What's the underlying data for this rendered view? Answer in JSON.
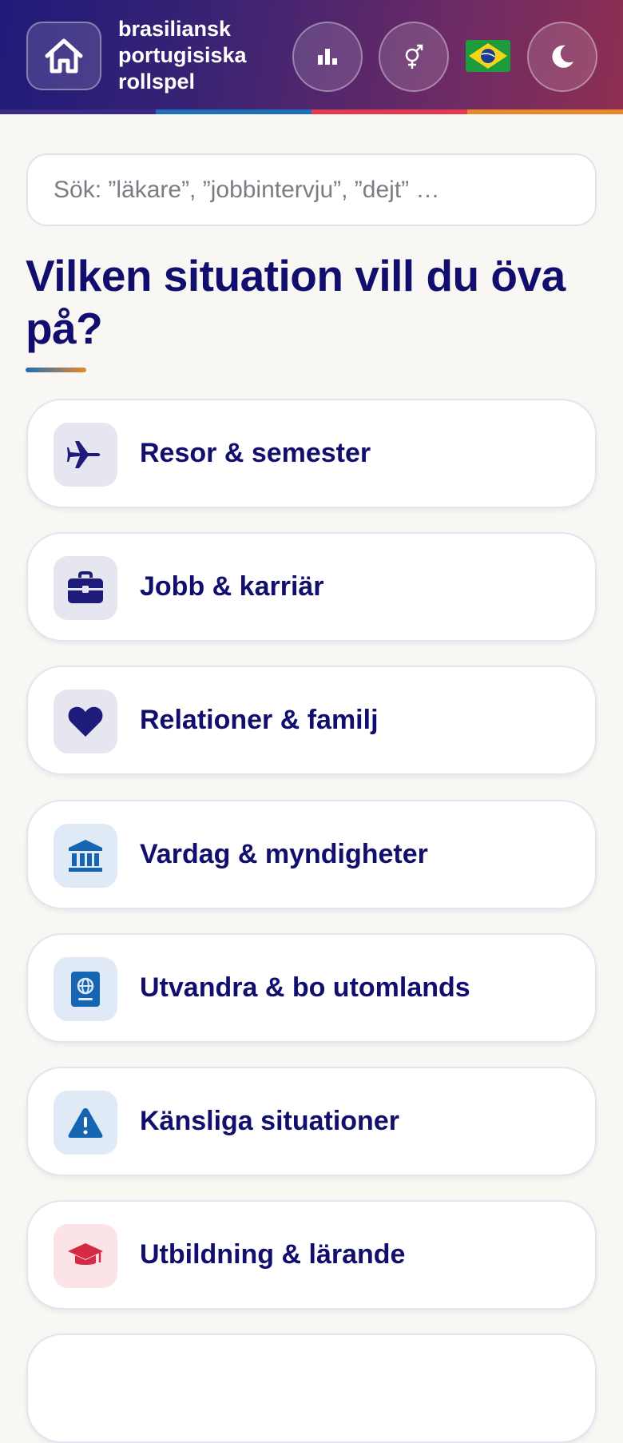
{
  "header": {
    "app_title": "brasiliansk\nportugisiska\nrollspel",
    "icons": {
      "home": "home-icon",
      "stats": "bar-chart-icon",
      "gender": "gender-icon",
      "flag": "brazil-flag-icon",
      "theme": "moon-icon"
    },
    "stripe_colors": [
      "#3a2a86",
      "#1e6fb8",
      "#e23a4f",
      "#e8872c"
    ]
  },
  "search": {
    "placeholder": "Sök: ”läkare”, ”jobbintervju”, ”dejt” …"
  },
  "main": {
    "heading": "Vilken situation vill du öva på?",
    "categories": [
      {
        "label": "Resor & semester",
        "icon": "airplane-icon"
      },
      {
        "label": "Jobb & karriär",
        "icon": "briefcase-icon"
      },
      {
        "label": "Relationer & familj",
        "icon": "heart-icon"
      },
      {
        "label": "Vardag & myndigheter",
        "icon": "bank-icon"
      },
      {
        "label": "Utvandra & bo utomlands",
        "icon": "passport-icon"
      },
      {
        "label": "Känsliga situationer",
        "icon": "warning-icon"
      },
      {
        "label": "Utbildning & lärande",
        "icon": "graduation-cap-icon"
      }
    ]
  },
  "colors": {
    "heading": "#110e6e",
    "accent_navy": "#1f1b7a",
    "accent_blue": "#1e6fb8",
    "accent_red": "#e23a4f",
    "accent_orange": "#e8872c"
  }
}
